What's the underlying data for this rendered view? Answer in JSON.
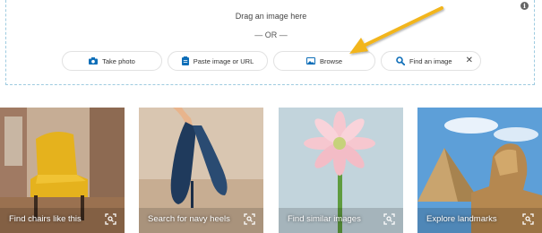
{
  "dropzone": {
    "drag_text": "Drag an image here",
    "or_text": "— OR —",
    "info_icon": "info-icon"
  },
  "buttons": {
    "take_photo": {
      "label": "Take photo",
      "icon": "camera-icon"
    },
    "paste": {
      "label": "Paste image or URL",
      "icon": "clipboard-icon"
    },
    "browse": {
      "label": "Browse",
      "icon": "image-icon"
    },
    "find": {
      "label": "Find an image",
      "icon": "search-icon",
      "close": "✕"
    }
  },
  "colors": {
    "accent_blue": "#0e6eb8",
    "arrow": "#f2b51c",
    "dropzone_border": "#9ecbe0"
  },
  "cards": [
    {
      "label": "Find chairs like this",
      "icon": "visual-search-icon"
    },
    {
      "label": "Search for navy heels",
      "icon": "visual-search-icon"
    },
    {
      "label": "Find similar images",
      "icon": "visual-search-icon"
    },
    {
      "label": "Explore landmarks",
      "icon": "visual-search-icon"
    }
  ]
}
